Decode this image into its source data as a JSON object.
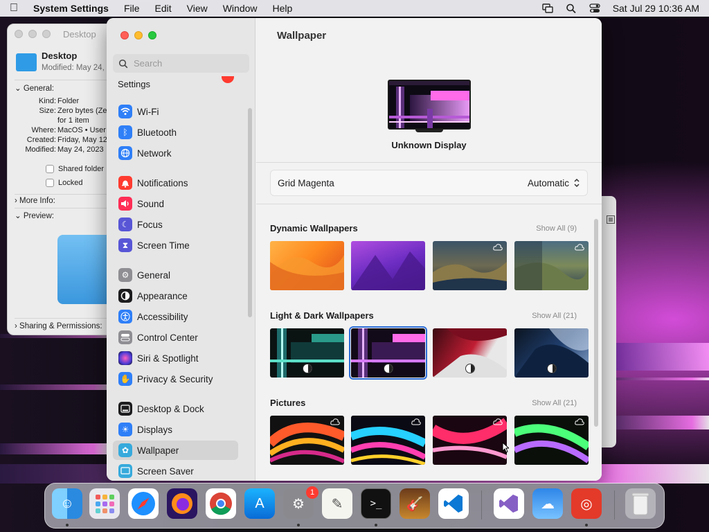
{
  "menubar": {
    "app": "System Settings",
    "menus": [
      "File",
      "Edit",
      "View",
      "Window",
      "Help"
    ],
    "clock": "Sat Jul 29  10:36 AM"
  },
  "finder_info": {
    "title": "Desktop",
    "name": "Desktop",
    "modified_short": "Modified: May 24,",
    "general_label": "General:",
    "rows": [
      {
        "k": "Kind:",
        "v": "Folder"
      },
      {
        "k": "Size:",
        "v": "Zero bytes (Ze"
      },
      {
        "k": "",
        "v": "for 1 item"
      },
      {
        "k": "Where:",
        "v": "MacOS • User"
      },
      {
        "k": "Created:",
        "v": "Friday, May 12"
      },
      {
        "k": "Modified:",
        "v": "May 24, 2023"
      }
    ],
    "shared_label": "Shared folder",
    "locked_label": "Locked",
    "more_info": "More Info:",
    "preview": "Preview:",
    "sharing": "Sharing & Permissions:"
  },
  "sidebar": {
    "search_placeholder": "Search",
    "settings_label": "Settings",
    "items": [
      {
        "label": "Wi-Fi",
        "icon": "wifi-icon",
        "color": "#2f7ff7"
      },
      {
        "label": "Bluetooth",
        "icon": "bluetooth-icon",
        "color": "#2f7ff7"
      },
      {
        "label": "Network",
        "icon": "globe-icon",
        "color": "#2f7ff7"
      },
      {
        "label": "Notifications",
        "icon": "bell-icon",
        "color": "#ff3b30"
      },
      {
        "label": "Sound",
        "icon": "speaker-icon",
        "color": "#ff2d55"
      },
      {
        "label": "Focus",
        "icon": "moon-icon",
        "color": "#5856d6"
      },
      {
        "label": "Screen Time",
        "icon": "hourglass-icon",
        "color": "#5856d6"
      },
      {
        "label": "General",
        "icon": "gear-icon",
        "color": "#8e8e93"
      },
      {
        "label": "Appearance",
        "icon": "appearance-icon",
        "color": "#1c1c1e"
      },
      {
        "label": "Accessibility",
        "icon": "accessibility-icon",
        "color": "#2f7ff7"
      },
      {
        "label": "Control Center",
        "icon": "control-center-icon",
        "color": "#8e8e93"
      },
      {
        "label": "Siri & Spotlight",
        "icon": "siri-icon",
        "color": "#b84ad6"
      },
      {
        "label": "Privacy & Security",
        "icon": "hand-icon",
        "color": "#2f7ff7"
      },
      {
        "label": "Desktop & Dock",
        "icon": "dock-icon",
        "color": "#1c1c1e"
      },
      {
        "label": "Displays",
        "icon": "sun-icon",
        "color": "#2f7ff7"
      },
      {
        "label": "Wallpaper",
        "icon": "wallpaper-icon",
        "color": "#36aadc"
      },
      {
        "label": "Screen Saver",
        "icon": "screensaver-icon",
        "color": "#36aadc"
      }
    ]
  },
  "main": {
    "title": "Wallpaper",
    "display_name": "Unknown Display",
    "current_wallpaper": "Grid Magenta",
    "mode": "Automatic",
    "sections": [
      {
        "title": "Dynamic Wallpapers",
        "show_all": "Show All (9)"
      },
      {
        "title": "Light & Dark Wallpapers",
        "show_all": "Show All (21)"
      },
      {
        "title": "Pictures",
        "show_all": "Show All (21)"
      }
    ]
  },
  "dock": {
    "apps": [
      "finder",
      "launchpad",
      "safari",
      "firefox",
      "chrome",
      "app-store",
      "system-settings",
      "textedit",
      "terminal",
      "garageband",
      "vscode",
      "visual-studio",
      "weather",
      "instruments",
      "trash"
    ],
    "settings_badge": "1"
  }
}
